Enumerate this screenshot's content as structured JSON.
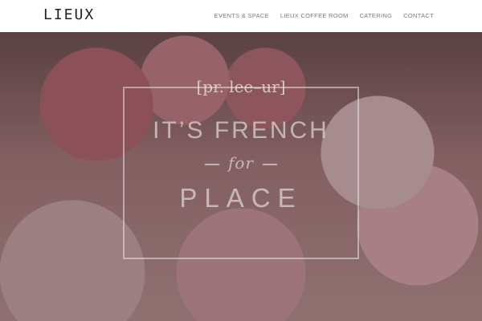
{
  "header": {
    "logo": "LIEUX",
    "nav": [
      {
        "label": "EVENTS & SPACE"
      },
      {
        "label": "LIEUX COFFEE ROOM"
      },
      {
        "label": "CATERING"
      },
      {
        "label": "CONTACT"
      }
    ]
  },
  "hero": {
    "pronunciation": "[pr. lee–ur]",
    "line1": "IT’S FRENCH",
    "line2": "for",
    "line3": "PLACE"
  }
}
